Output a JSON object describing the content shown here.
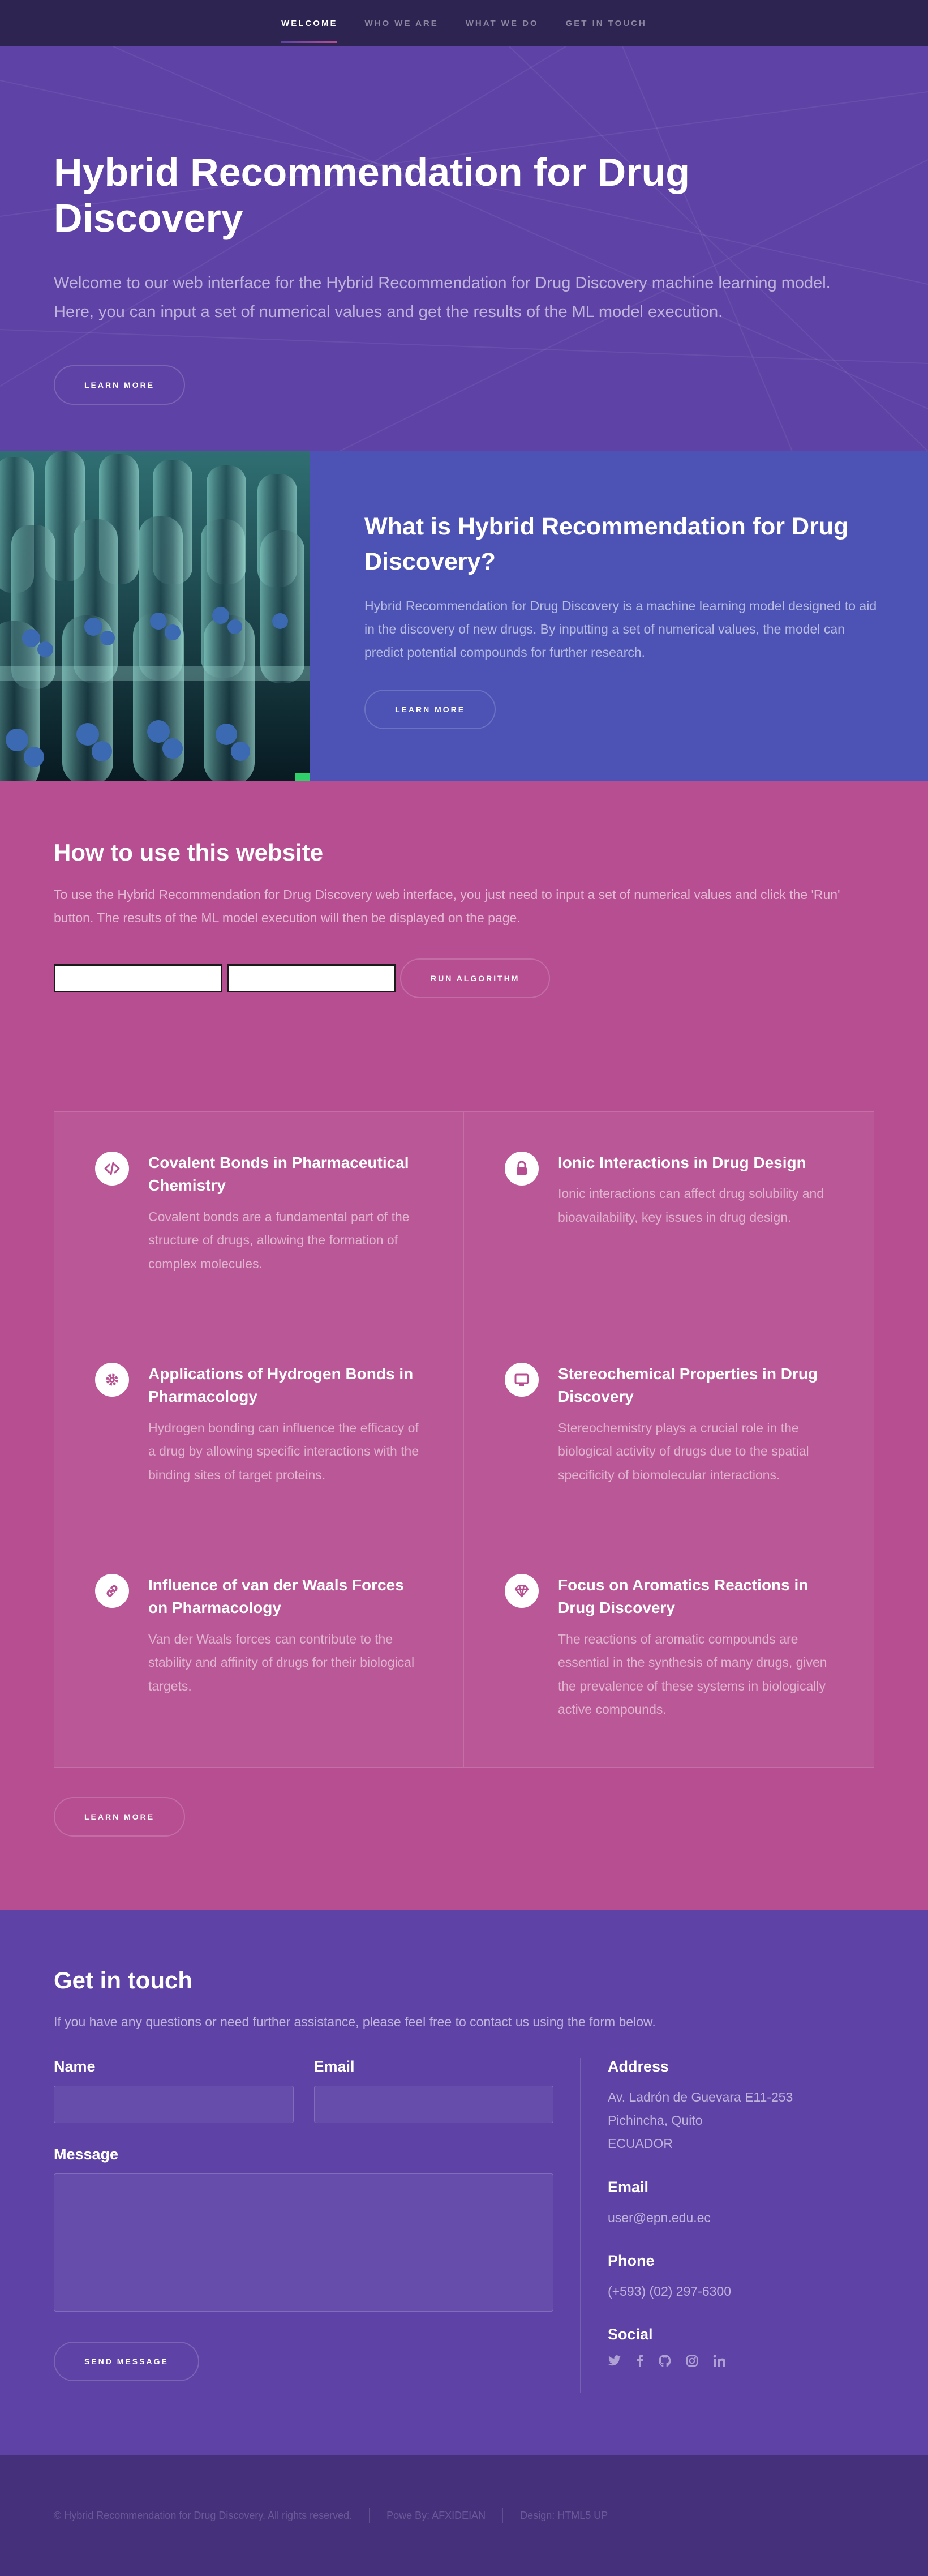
{
  "nav": {
    "items": [
      {
        "label": "WELCOME",
        "active": true
      },
      {
        "label": "WHO WE ARE",
        "active": false
      },
      {
        "label": "WHAT WE DO",
        "active": false
      },
      {
        "label": "GET IN TOUCH",
        "active": false
      }
    ]
  },
  "hero": {
    "title": "Hybrid Recommendation for Drug Discovery",
    "text": "Welcome to our web interface for the Hybrid Recommendation for Drug Discovery machine learning model. Here, you can input a set of numerical values and get the results of the ML model execution.",
    "button": "LEARN MORE"
  },
  "about": {
    "title": "What is Hybrid Recommendation for Drug Discovery?",
    "text": "Hybrid Recommendation for Drug Discovery is a machine learning model designed to aid in the discovery of new drugs. By inputting a set of numerical values, the model can predict potential compounds for further research.",
    "button": "LEARN MORE",
    "image_alt": "test-tubes-photo"
  },
  "howto": {
    "title": "How to use this website",
    "text": "To use the Hybrid Recommendation for Drug Discovery web interface, you just need to input a set of numerical values and click the 'Run' button. The results of the ML model execution will then be displayed on the page.",
    "run_button": "RUN ALGORITHM",
    "features": [
      {
        "icon": "code-icon",
        "title": "Covalent Bonds in Pharmaceutical Chemistry",
        "text": "Covalent bonds are a fundamental part of the structure of drugs, allowing the formation of complex molecules."
      },
      {
        "icon": "lock-icon",
        "title": "Ionic Interactions in Drug Design",
        "text": "Ionic interactions can affect drug solubility and bioavailability, key issues in drug design."
      },
      {
        "icon": "gear-icon",
        "title": "Applications of Hydrogen Bonds in Pharmacology",
        "text": "Hydrogen bonding can influence the efficacy of a drug by allowing specific interactions with the binding sites of target proteins."
      },
      {
        "icon": "desktop-icon",
        "title": "Stereochemical Properties in Drug Discovery",
        "text": "Stereochemistry plays a crucial role in the biological activity of drugs due to the spatial specificity of biomolecular interactions."
      },
      {
        "icon": "link-icon",
        "title": "Influence of van der Waals Forces on Pharmacology",
        "text": "Van der Waals forces can contribute to the stability and affinity of drugs for their biological targets."
      },
      {
        "icon": "diamond-icon",
        "title": "Focus on Aromatics Reactions in Drug Discovery",
        "text": "The reactions of aromatic compounds are essential in the synthesis of many drugs, given the prevalence of these systems in biologically active compounds."
      }
    ],
    "button": "LEARN MORE"
  },
  "contact": {
    "title": "Get in touch",
    "lead": "If you have any questions or need further assistance, please feel free to contact us using the form below.",
    "name_label": "Name",
    "email_label": "Email",
    "message_label": "Message",
    "send_button": "SEND MESSAGE",
    "address_label": "Address",
    "address_lines": [
      "Av. Ladrón de Guevara E11-253",
      "Pichincha, Quito",
      "ECUADOR"
    ],
    "email_heading": "Email",
    "email_value": "user@epn.edu.ec",
    "phone_label": "Phone",
    "phone_value": "(+593) (02) 297-6300",
    "social_label": "Social",
    "social_icons": [
      "twitter-icon",
      "facebook-icon",
      "github-icon",
      "instagram-icon",
      "linkedin-icon"
    ]
  },
  "footer": {
    "copyright": "© Hybrid Recommendation for Drug Discovery. All rights reserved.",
    "power": "Powe By: AFXIDEIAN",
    "design": "Design: HTML5 UP"
  }
}
